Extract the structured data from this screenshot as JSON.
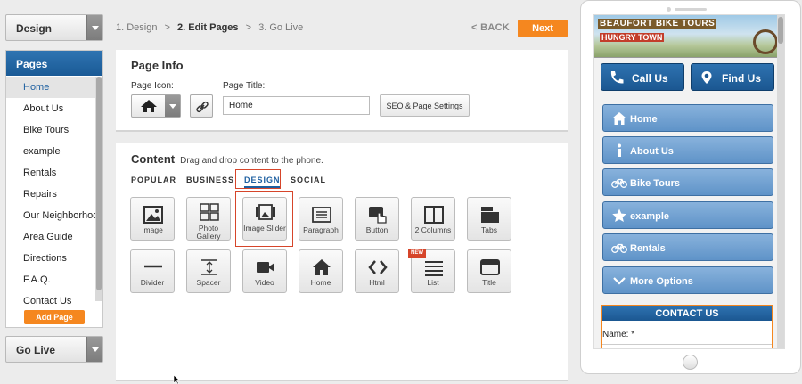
{
  "left": {
    "design_dropdown": "Design",
    "pages_header": "Pages",
    "pages": [
      "Home",
      "About Us",
      "Bike Tours",
      "example",
      "Rentals",
      "Repairs",
      "Our Neighborhood",
      "Area Guide",
      "Directions",
      "F.A.Q.",
      "Contact Us"
    ],
    "add_page": "Add Page",
    "golive_dropdown": "Go Live"
  },
  "steps": {
    "step1": "1. Design",
    "sep": ">",
    "step2": "2. Edit Pages",
    "step3": "3. Go Live",
    "back": "< BACK",
    "next": "Next"
  },
  "page_info": {
    "title": "Page Info",
    "icon_label": "Page Icon:",
    "title_label": "Page Title:",
    "title_value": "Home",
    "seo_button": "SEO & Page Settings"
  },
  "content": {
    "title": "Content",
    "subtitle": "Drag and drop content to the phone.",
    "tabs": [
      "POPULAR",
      "BUSINESS",
      "DESIGN",
      "SOCIAL"
    ],
    "active_tab": "DESIGN",
    "tiles_row1": [
      "Image",
      "Photo Gallery",
      "Image Slider",
      "Paragraph",
      "Button",
      "2 Columns",
      "Tabs"
    ],
    "tiles_row2": [
      "Divider",
      "Spacer",
      "Video",
      "Home",
      "Html",
      "List",
      "Title"
    ],
    "new_badge": "NEW"
  },
  "phone": {
    "banner_line1": "BEAUFORT BIKE TOURS",
    "banner_line2": "HUNGRY TOWN",
    "call_button": "Call Us",
    "find_button": "Find Us",
    "nav": [
      "Home",
      "About Us",
      "Bike Tours",
      "example",
      "Rentals",
      "More Options"
    ],
    "contact_header": "CONTACT US",
    "name_label": "Name:  *"
  },
  "colors": {
    "accent_orange": "#f5871f",
    "primary_blue": "#1d5fa0",
    "nav_blue": "#6e9fd0",
    "highlight_red": "#d6452a"
  }
}
